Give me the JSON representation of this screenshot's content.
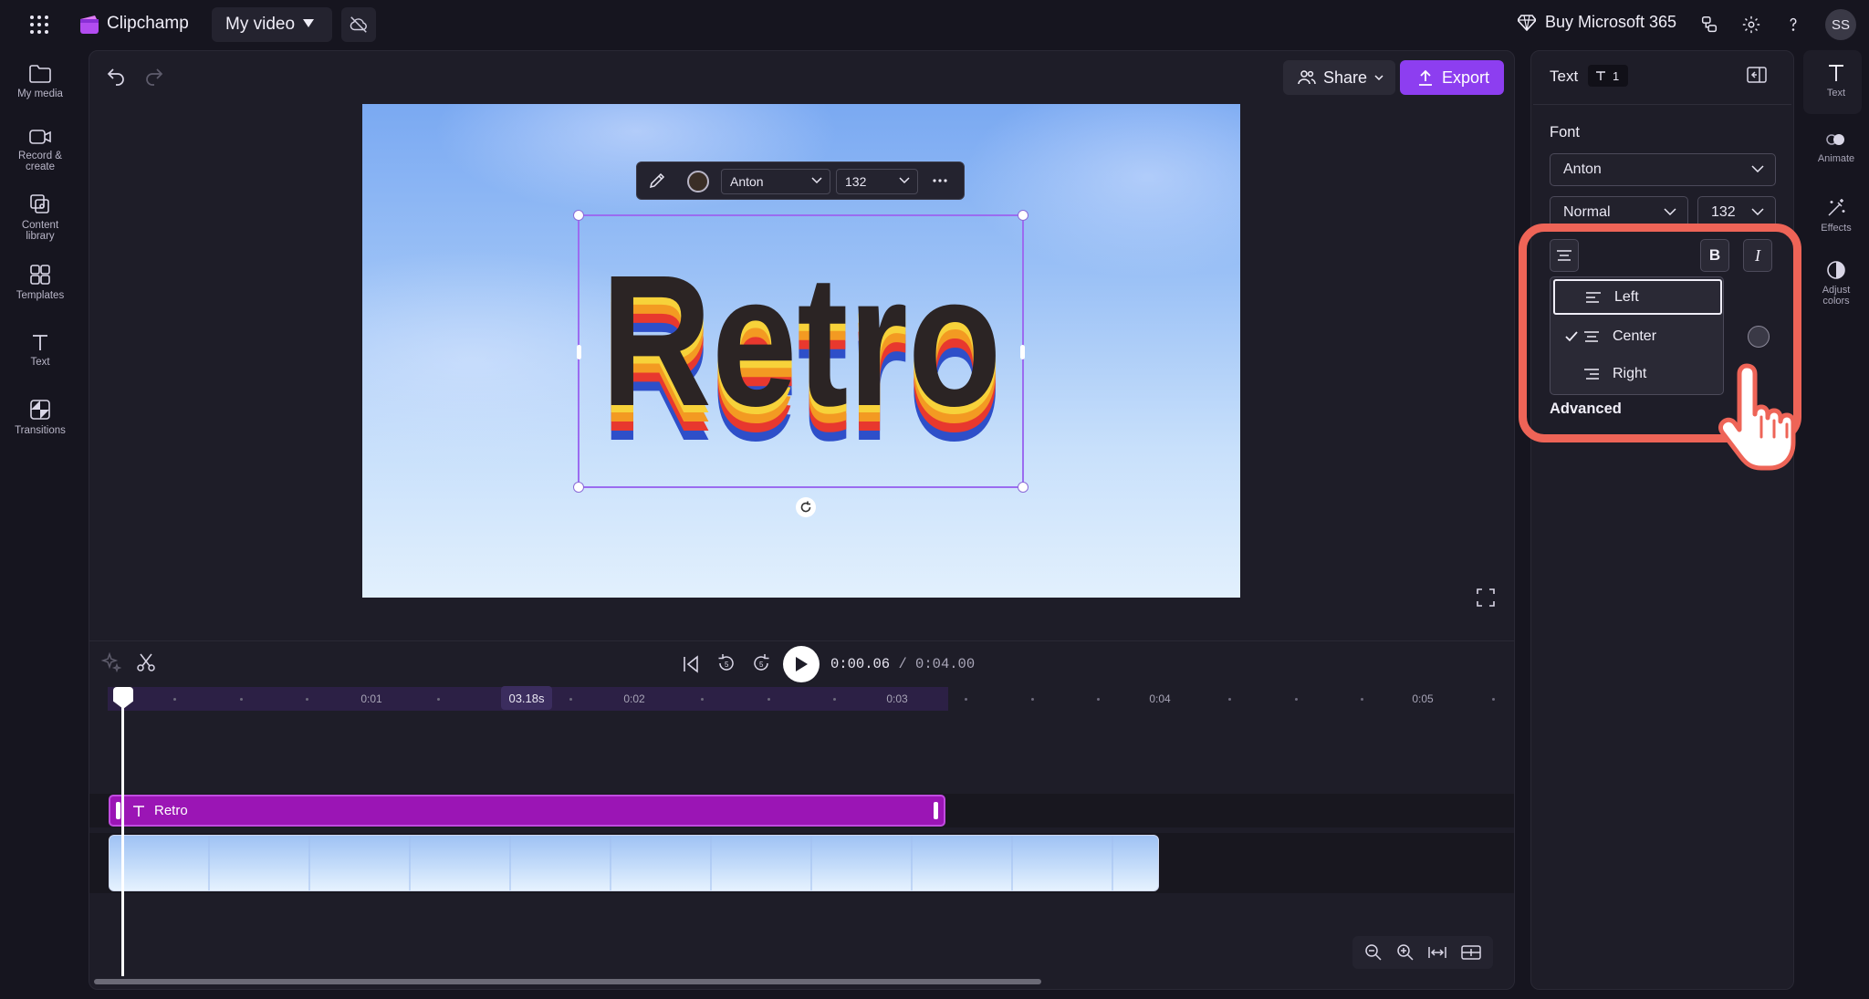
{
  "app": {
    "name": "Clipchamp",
    "project": "My video",
    "buy_label": "Buy Microsoft 365",
    "avatar": "SS"
  },
  "colors": {
    "accent": "#8d3ef0",
    "text_clip": "#9b15b5",
    "highlight": "#ee6457",
    "bg": "#16151f"
  },
  "left_rail": [
    {
      "label": "My media",
      "icon": "folder-icon"
    },
    {
      "label": "Record & create",
      "icon": "camera-icon"
    },
    {
      "label": "Content library",
      "icon": "content-library-icon"
    },
    {
      "label": "Templates",
      "icon": "templates-icon"
    },
    {
      "label": "Text",
      "icon": "text-icon"
    },
    {
      "label": "Transitions",
      "icon": "transitions-icon"
    }
  ],
  "toolbar": {
    "share_label": "Share",
    "export_label": "Export"
  },
  "preview": {
    "text": "Retro",
    "floating_toolbar": {
      "font": "Anton",
      "size": "132"
    }
  },
  "timeline": {
    "current_time": "0:00.06",
    "duration": "/ 0:04.00",
    "hover_time": "03.18s",
    "ruler_labels": [
      "0:01",
      "0:02",
      "0:03",
      "0:04",
      "0:05"
    ],
    "text_clip_label": "Retro"
  },
  "properties": {
    "title": "Text",
    "badge_count": "1",
    "font_section": "Font",
    "font_value": "Anton",
    "weight_value": "Normal",
    "size_value": "132",
    "bold_label": "B",
    "italic_label": "I",
    "align_options": [
      "Left",
      "Center",
      "Right"
    ],
    "align_selected": "Center",
    "advanced_label": "Advanced"
  },
  "right_rail": [
    {
      "label": "Text",
      "icon": "text-icon"
    },
    {
      "label": "Animate",
      "icon": "animate-icon"
    },
    {
      "label": "Effects",
      "icon": "effects-icon"
    },
    {
      "label": "Adjust colors",
      "icon": "adjust-colors-icon"
    }
  ]
}
